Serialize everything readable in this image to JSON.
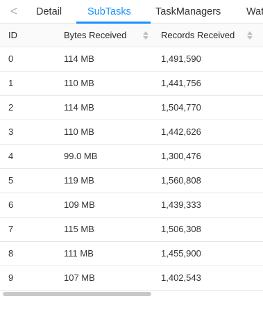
{
  "tabs": {
    "prev_arrow": "<",
    "items": [
      "Detail",
      "SubTasks",
      "TaskManagers",
      "Wat"
    ],
    "active": "SubTasks"
  },
  "table": {
    "columns": [
      "ID",
      "Bytes Received",
      "Records Received"
    ],
    "rows": [
      {
        "id": "0",
        "bytes": "114 MB",
        "records": "1,491,590"
      },
      {
        "id": "1",
        "bytes": "110 MB",
        "records": "1,441,756"
      },
      {
        "id": "2",
        "bytes": "114 MB",
        "records": "1,504,770"
      },
      {
        "id": "3",
        "bytes": "110 MB",
        "records": "1,442,626"
      },
      {
        "id": "4",
        "bytes": "99.0 MB",
        "records": "1,300,476"
      },
      {
        "id": "5",
        "bytes": "119 MB",
        "records": "1,560,808"
      },
      {
        "id": "6",
        "bytes": "109 MB",
        "records": "1,439,333"
      },
      {
        "id": "7",
        "bytes": "115 MB",
        "records": "1,506,308"
      },
      {
        "id": "8",
        "bytes": "111 MB",
        "records": "1,455,900"
      },
      {
        "id": "9",
        "bytes": "107 MB",
        "records": "1,402,543"
      }
    ]
  },
  "colors": {
    "accent": "#1890ff",
    "border": "#e8e8e8",
    "header_bg": "#fafafa"
  }
}
